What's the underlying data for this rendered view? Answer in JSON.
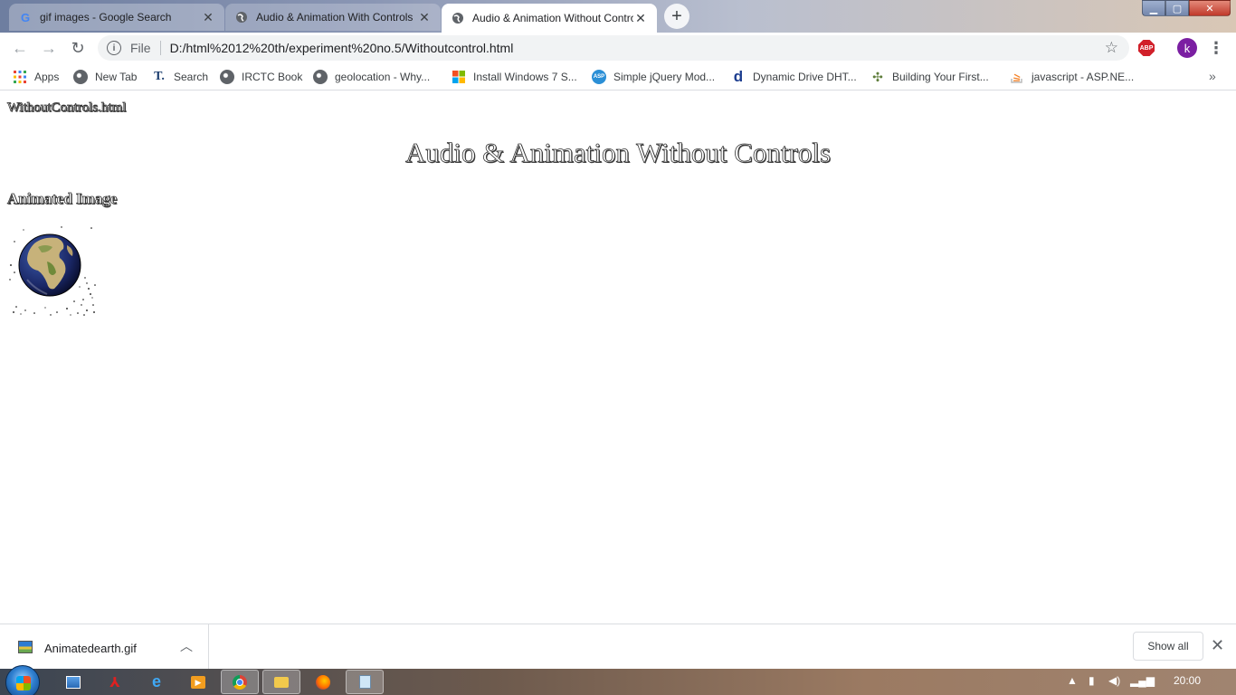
{
  "browser": {
    "tabs": [
      {
        "title": "gif images - Google Search",
        "favicon": "google-icon",
        "active": false
      },
      {
        "title": "Audio & Animation With Controls",
        "favicon": "globe-icon",
        "active": false
      },
      {
        "title": "Audio & Animation Without Controls",
        "favicon": "globe-icon",
        "active": true
      }
    ],
    "new_tab_label": "+",
    "address_bar": {
      "scheme_label": "File",
      "url": "D:/html%2012%20th/experiment%20no.5/Withoutcontrol.html"
    },
    "extension_badge": "ABP",
    "profile_initial": "k",
    "bookmarks": [
      {
        "label": "Apps",
        "icon": "apps-grid-icon"
      },
      {
        "label": "New Tab",
        "icon": "globe-icon"
      },
      {
        "label": "Search",
        "icon": "search-t-icon"
      },
      {
        "label": "IRCTC Book",
        "icon": "globe-icon"
      },
      {
        "label": "geolocation - Why...",
        "icon": "globe-icon"
      },
      {
        "label": "Install Windows 7 S...",
        "icon": "windows-logo-icon"
      },
      {
        "label": "Simple jQuery Mod...",
        "icon": "asp-icon"
      },
      {
        "label": "Dynamic Drive DHT...",
        "icon": "dynamic-drive-icon"
      },
      {
        "label": "Building Your First...",
        "icon": "puzzle-icon"
      },
      {
        "label": "javascript - ASP.NE...",
        "icon": "stackoverflow-icon"
      }
    ]
  },
  "page": {
    "file_label": "WithoutControls.html",
    "heading": "Audio & Animation Without Controls",
    "subheading": "Animated Image",
    "image_name": "animated-earth"
  },
  "download_shelf": {
    "file_name": "Animatedearth.gif",
    "show_all_label": "Show all"
  },
  "taskbar": {
    "clock": "20:00"
  },
  "colors": {
    "close_red": "#c0392b",
    "profile_purple": "#7b1fa2",
    "abp_red": "#d1202a"
  }
}
